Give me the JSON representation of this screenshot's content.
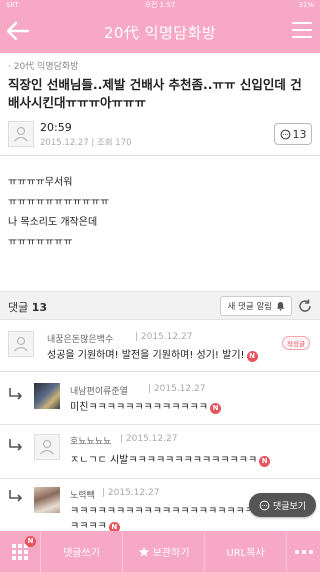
{
  "status_bar": {
    "carrier": "SKT",
    "time": "오전 1:57",
    "battery": "31%"
  },
  "header": {
    "title": "20代 익명담화방"
  },
  "post": {
    "board": "20代 익명담화방",
    "title": "직장인 선배님들..제발 건배사 추천좀..ㅠㅠ 신입인데 건배사시킨대ㅠㅠㅠ아ㅠㅠㅠ",
    "time": "20:59",
    "date": "2015.12.27",
    "views_label": "조회",
    "views": "170",
    "comment_count": "13",
    "body_lines": [
      "ㅠㅠㅠㅠ무서워",
      "ㅠㅠㅠㅠㅠㅠㅠㅠㅠㅠㅠ",
      "나 목소리도 개작은데",
      "ㅠㅠㅠㅠㅠㅠㅠ"
    ]
  },
  "comments_bar": {
    "label": "댓글",
    "count": "13",
    "notify_label": "새 댓글 알림"
  },
  "comments": [
    {
      "author": "내꿈은돈많은백수",
      "date": "2015.12.27",
      "text": "성공을 기원하며! 발전을 기원하며! 성기! 발기!",
      "badge": "N",
      "writer_badge": "작성글"
    },
    {
      "author": "내남편이류준열",
      "date": "2015.12.27",
      "text": "미친ㅋㅋㅋㅋㅋㅋㅋㅋㅋㅋㅋㅋㅋ",
      "badge": "N"
    },
    {
      "author": "호뇨뇨뇨뇨",
      "date": "2015.12.27",
      "text": "ㅈㄴㄱㄷ 시발ㅋㅋㅋㅋㅋㅋㅋㅋㅋㅋㅋㅋㅋㅋ",
      "badge": "N"
    },
    {
      "author": "노력빽",
      "date": "2015.12.27",
      "text_line1": "ㅋㅋㅋㅋㅋㅋㅋㅋㅋㅋㅋㅋㅋㅋㅋㅋㅋㅋㅋㅋ",
      "text_line2": "ㅋㅋㅋㅋ",
      "badge": "N"
    }
  ],
  "float_button": {
    "label": "댓글보기"
  },
  "toolbar": {
    "grid_badge": "N",
    "items": [
      {
        "label": "댓글쓰기"
      },
      {
        "label": "보관하기"
      },
      {
        "label": "URL복사"
      }
    ]
  },
  "colors": {
    "accent": "#f7a8c4",
    "badge": "#e8545e"
  },
  "icons": [
    "back-arrow-icon",
    "hamburger-menu-icon",
    "person-icon",
    "comment-bubble-icon",
    "bell-icon",
    "refresh-icon",
    "reply-arrow-icon",
    "grid-icon",
    "star-icon",
    "more-dots-icon"
  ]
}
